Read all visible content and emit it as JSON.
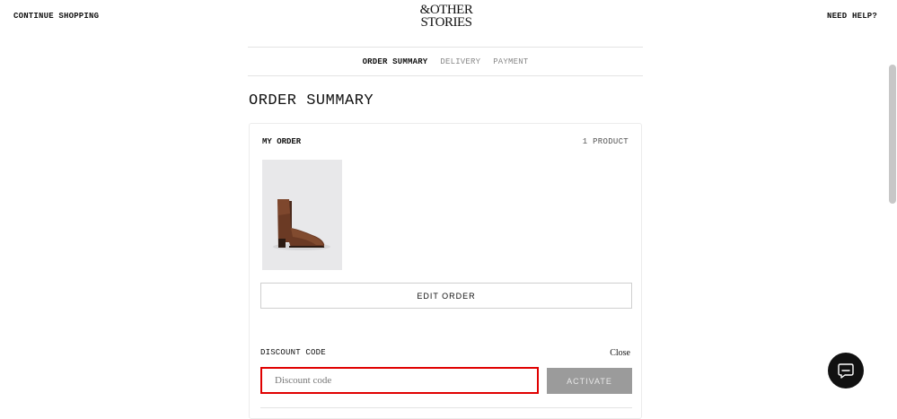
{
  "header": {
    "continue_label": "CONTINUE SHOPPING",
    "help_label": "NEED HELP?",
    "logo_line1": "&OTHER",
    "logo_line2": "STORIES"
  },
  "steps": [
    {
      "label": "ORDER SUMMARY",
      "active": true
    },
    {
      "label": "DELIVERY",
      "active": false
    },
    {
      "label": "PAYMENT",
      "active": false
    }
  ],
  "page_title": "ORDER SUMMARY",
  "order": {
    "section_label": "MY ORDER",
    "product_count": "1 PRODUCT",
    "edit_label": "EDIT ORDER"
  },
  "discount": {
    "label": "DISCOUNT CODE",
    "close_label": "Close",
    "input_value": "",
    "placeholder": "Discount code",
    "activate_label": "ACTIVATE"
  },
  "icons": {
    "chat": "chat-bubble-icon",
    "product_image": "ankle-boot-image"
  },
  "colors": {
    "highlight_border": "#e00000",
    "activate_bg": "#9b9b9b",
    "chat_bg": "#111111"
  }
}
